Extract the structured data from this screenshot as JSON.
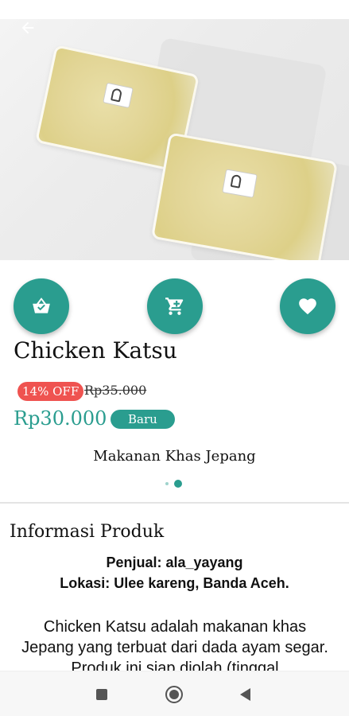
{
  "product": {
    "name": "Chicken Katsu",
    "discount": "14% OFF",
    "original_price": "Rp35.000",
    "price": "Rp30.000",
    "condition": "Baru",
    "category": "Makanan Khas Jepang"
  },
  "carousel": {
    "total": 2,
    "active": 2
  },
  "info": {
    "section_title": "Informasi Produk",
    "seller": "Penjual: ala_yayang",
    "location": "Lokasi: Ulee kareng, Banda Aceh.",
    "description": "Chicken Katsu adalah makanan khas Jepang yang terbuat dari dada ayam segar. Produk ini siap diolah (tinggal"
  },
  "icons": {
    "back": "arrow-back-icon",
    "basket": "basket-check-icon",
    "cart": "cart-icon",
    "favorite": "heart-icon",
    "nav_recents": "square-icon",
    "nav_home": "circle-icon",
    "nav_back": "triangle-icon"
  },
  "colors": {
    "accent": "#2a9d8f",
    "discount": "#ef5350"
  }
}
